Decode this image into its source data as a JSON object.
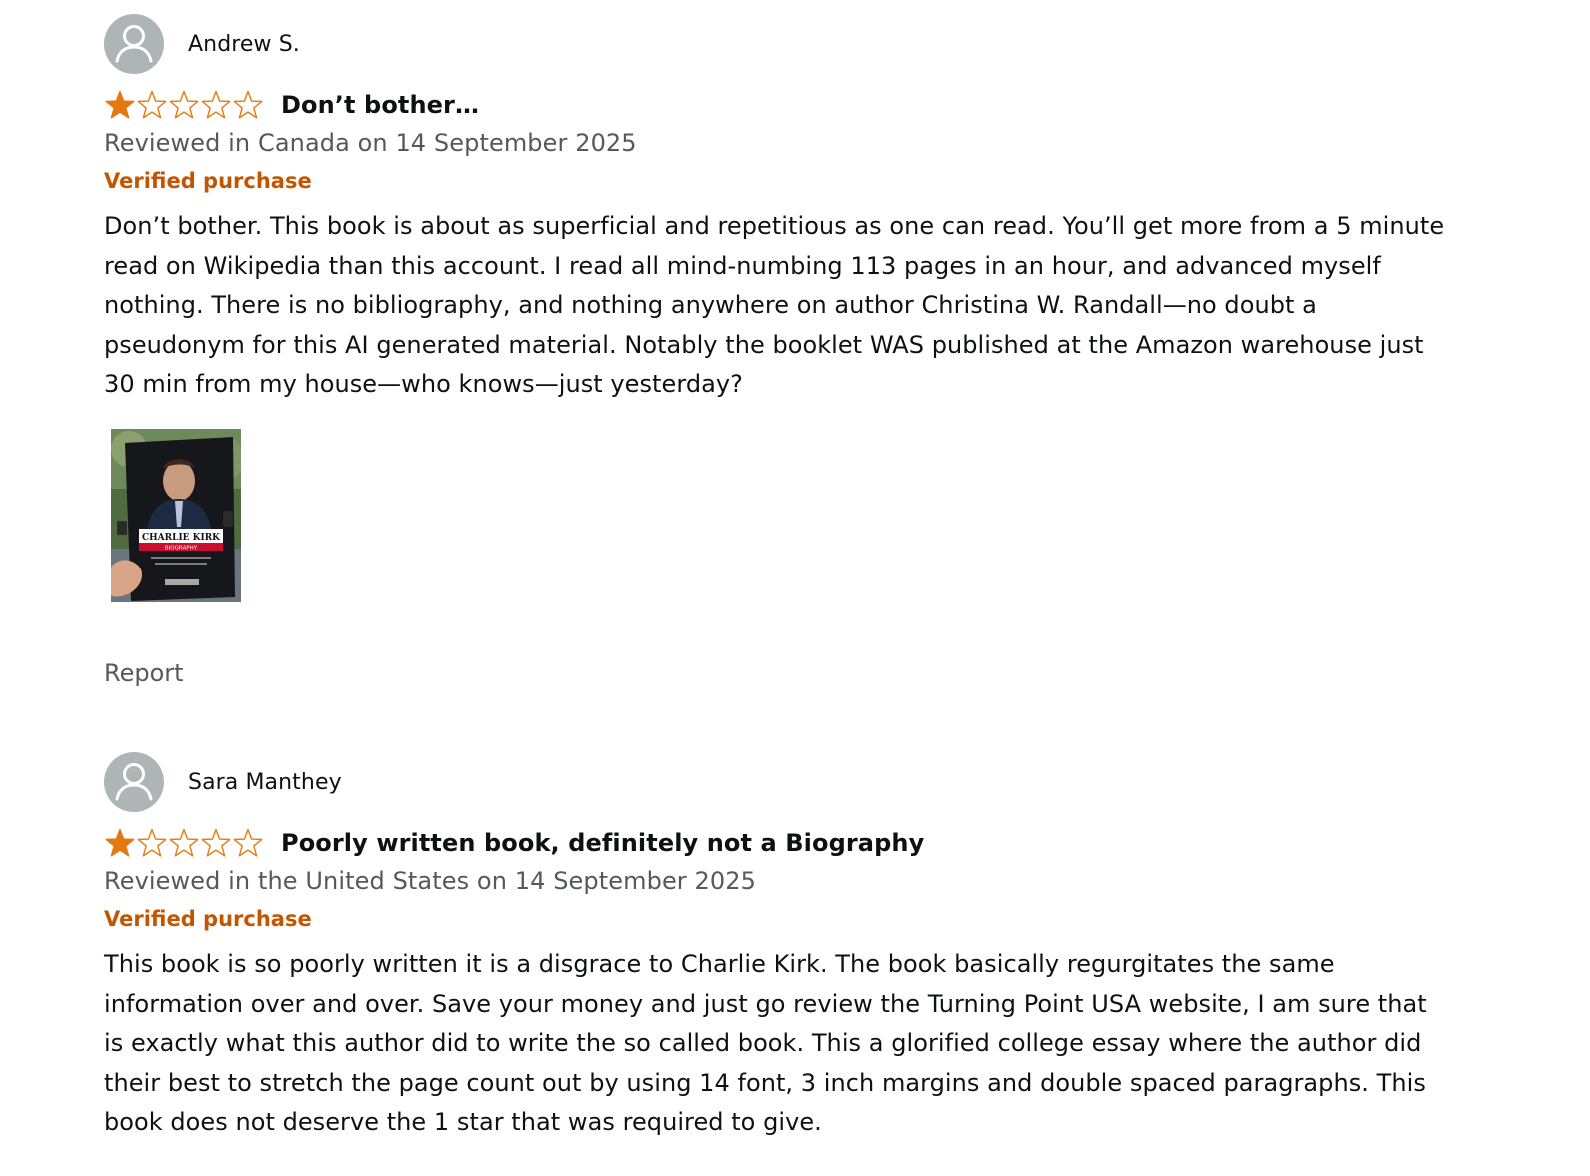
{
  "reviews": [
    {
      "reviewer": "Andrew S.",
      "rating": 1,
      "rating_max": 5,
      "title": "Don’t bother…",
      "date": "Reviewed in Canada on 14 September 2025",
      "verified": "Verified purchase",
      "body": "Don’t bother. This book is about as superficial and repetitious as one can read. You’ll get more from a 5 minute read on Wikipedia than this account. I read all mind-numbing 113 pages in an hour, and advanced myself nothing. There is no bibliography, and nothing anywhere on author Christina W. Randall—no doubt a pseudonym for this AI generated material. Notably the booklet WAS published at the Amazon warehouse just 30 min from my house—who knows—just yesterday?",
      "image": {
        "cover_title": "CHARLIE KIRK",
        "cover_subtitle": "BIOGRAPHY"
      },
      "report": "Report"
    },
    {
      "reviewer": "Sara Manthey",
      "rating": 1,
      "rating_max": 5,
      "title": "Poorly written book, definitely not a Biography",
      "date": "Reviewed in the United States on 14 September 2025",
      "verified": "Verified purchase",
      "body": "This book is so poorly written it is a disgrace to Charlie Kirk. The book basically regurgitates the same information over and over. Save your money and just go review the Turning Point USA website, I am sure that is exactly what this author did to write the so called book. This a glorified college essay where the author did their best to stretch the page count out by using 14 font, 3 inch margins and double spaced paragraphs. This book does not deserve the 1 star that was required to give."
    }
  ],
  "colors": {
    "star": "#e47911",
    "verified": "#c45500",
    "secondary_text": "#565959",
    "avatar_bg": "#adb5b7"
  },
  "icons": {
    "avatar": "default-user-avatar-icon",
    "star_filled": "star-filled-icon",
    "star_empty": "star-empty-icon"
  }
}
